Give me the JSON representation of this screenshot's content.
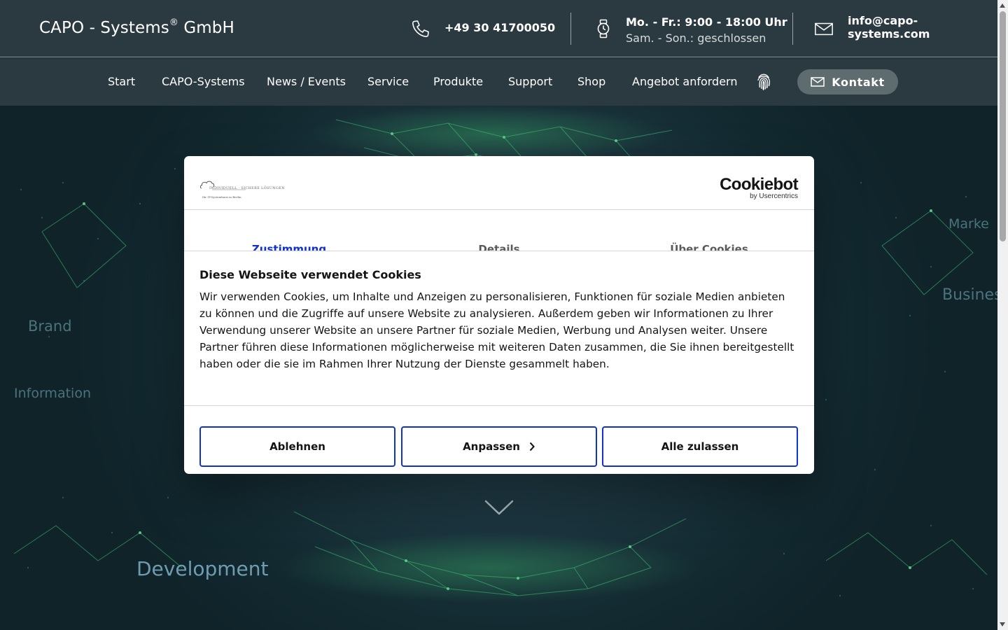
{
  "header": {
    "brand": "CAPO - Systems",
    "brand_reg": "®",
    "brand_suffix": " GmbH",
    "phone": "+49 30 41700050",
    "hours_line1": "Mo. - Fr.: 9:00 - 18:00 Uhr",
    "hours_line2": "Sam. - Son.: geschlossen",
    "email": "info@capo-systems.com",
    "icons": {
      "phone": "phone-icon",
      "hours": "watch-icon",
      "email": "mail-icon"
    }
  },
  "nav": {
    "items": [
      {
        "label": "Start"
      },
      {
        "label": "CAPO-Systems"
      },
      {
        "label": "News / Events"
      },
      {
        "label": "Service"
      },
      {
        "label": "Produkte"
      },
      {
        "label": "Support"
      },
      {
        "label": "Shop"
      },
      {
        "label": "Angebot anfordern"
      }
    ],
    "fingerprint_icon": "fingerprint-icon",
    "contact_button": "Kontakt"
  },
  "hero": {
    "words": [
      "Brand",
      "Information",
      "Business",
      "Marke",
      "Development"
    ],
    "scroll_icon": "chevron-down-icon"
  },
  "cookie_dialog": {
    "logo_line1": "INDIVIDUELL · SICHERE LÖSUNGEN",
    "logo_line2": "Ihr IT-Systemhaus in Berlin",
    "provider_logo": "Cookiebot",
    "provider_sub": "by Usercentrics",
    "tabs": [
      {
        "label": "Zustimmung",
        "active": true
      },
      {
        "label": "Details",
        "active": false
      },
      {
        "label": "Über Cookies",
        "active": false
      }
    ],
    "title": "Diese Webseite verwendet Cookies",
    "body": "Wir verwenden Cookies, um Inhalte und Anzeigen zu personalisieren, Funktionen für soziale Medien anbieten zu können und die Zugriffe auf unsere Website zu analysieren. Außerdem geben wir Informationen zu Ihrer Verwendung unserer Website an unsere Partner für soziale Medien, Werbung und Analysen weiter. Unsere Partner führen diese Informationen möglicherweise mit weiteren Daten zusammen, die Sie ihnen bereitgestellt haben oder die sie im Rahmen Ihrer Nutzung der Dienste gesammelt haben.",
    "buttons": {
      "deny": "Ablehnen",
      "customize": "Anpassen",
      "allow_all": "Alle zulassen"
    }
  },
  "colors": {
    "header_bg": "#2a3a40",
    "accent_blue": "#1032cf",
    "contact_button_bg": "#5e6b6f",
    "hero_network": "#3fc872"
  }
}
